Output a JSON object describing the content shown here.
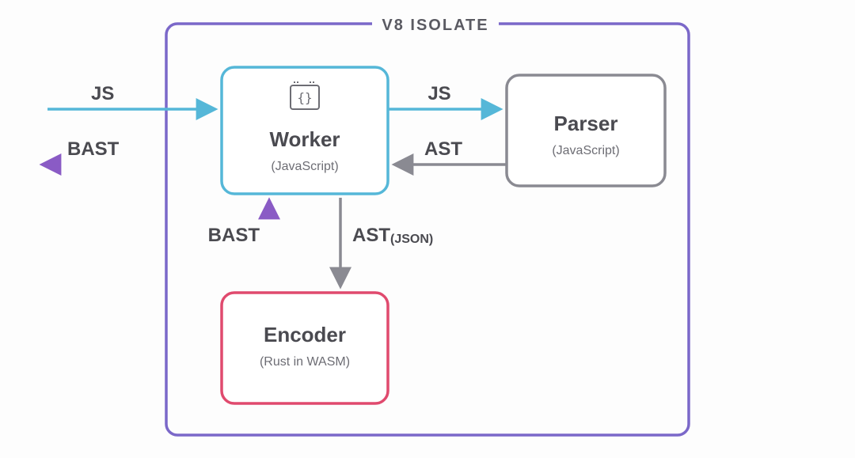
{
  "container": {
    "label": "V8 ISOLATE"
  },
  "nodes": {
    "worker": {
      "title": "Worker",
      "sub": "(JavaScript)"
    },
    "parser": {
      "title": "Parser",
      "sub": "(JavaScript)"
    },
    "encoder": {
      "title": "Encoder",
      "sub": "(Rust in WASM)"
    }
  },
  "edges": {
    "js_in": {
      "label": "JS"
    },
    "bast_out": {
      "label": "BAST"
    },
    "worker_parser": {
      "label": "JS"
    },
    "parser_worker": {
      "label": "AST"
    },
    "worker_encoder": {
      "label": "AST",
      "small": "(JSON)"
    },
    "encoder_worker": {
      "label": "BAST"
    }
  },
  "colors": {
    "containerStroke": "#7b68c9",
    "workerStroke": "#55b7d8",
    "parserStroke": "#8a8a92",
    "encoderStroke": "#e04a6e",
    "arrowBlue": "#55b7d8",
    "arrowGrey": "#8a8a92",
    "arrowPurple": "#8a5bc5"
  }
}
